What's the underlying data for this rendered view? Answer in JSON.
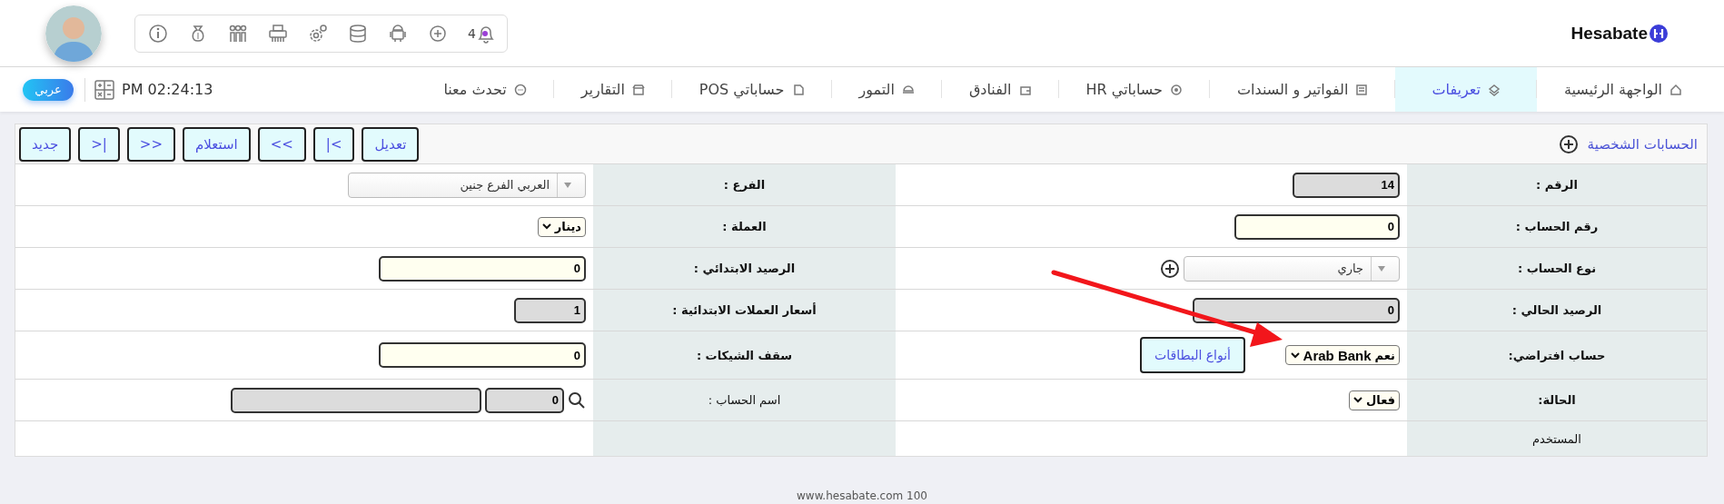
{
  "header": {
    "logo": "Hesabate",
    "notification_count": "4"
  },
  "nav": {
    "language_button": "عربي",
    "clock": "PM 02:24:13",
    "tabs": [
      {
        "label": "الواجهة الرئيسية",
        "selected": false
      },
      {
        "label": "تعريفات",
        "selected": true
      },
      {
        "label": "الفواتير و السندات",
        "selected": false
      },
      {
        "label": "حساباتي HR",
        "selected": false
      },
      {
        "label": "الفنادق",
        "selected": false
      },
      {
        "label": "التمور",
        "selected": false
      },
      {
        "label": "حساباتي POS",
        "selected": false
      },
      {
        "label": "التقارير",
        "selected": false
      },
      {
        "label": "تحدث معنا",
        "selected": false
      }
    ]
  },
  "panel": {
    "title": "الحسابات الشخصية",
    "buttons": [
      "تعديل",
      "|<",
      "<<",
      "استعلام",
      ">>",
      ">|",
      "جديد"
    ],
    "rows": [
      {
        "cells": [
          {
            "label": "الرقم :",
            "controls": [
              {
                "kind": "input",
                "value": "14",
                "readonly": true
              }
            ]
          },
          {
            "label": "الفرع :",
            "controls": [
              {
                "kind": "combo",
                "value": "العربي الفرع جنين"
              }
            ]
          }
        ]
      },
      {
        "cells": [
          {
            "label": "رقم الحساب :",
            "controls": [
              {
                "kind": "input",
                "value": "0",
                "readonly": false
              }
            ]
          },
          {
            "label": "العملة :",
            "controls": [
              {
                "kind": "select",
                "value": "دينار"
              }
            ]
          }
        ]
      },
      {
        "cells": [
          {
            "label": "نوع الحساب :",
            "controls": [
              {
                "kind": "combo",
                "value": "جاري"
              },
              {
                "kind": "add"
              }
            ]
          },
          {
            "label": "الرصيد الابتدائي :",
            "controls": [
              {
                "kind": "input",
                "value": "0",
                "readonly": false
              }
            ]
          }
        ]
      },
      {
        "cells": [
          {
            "label": "الرصيد الحالي :",
            "controls": [
              {
                "kind": "input",
                "value": "0",
                "readonly": true
              }
            ]
          },
          {
            "label": "أسعار العملات الابتدائية :",
            "controls": [
              {
                "kind": "input",
                "value": "1",
                "readonly": true
              }
            ]
          }
        ]
      },
      {
        "cells": [
          {
            "label": "حساب افتراضي:",
            "controls": [
              {
                "kind": "select",
                "value": "نعم",
                "note": "Arab Bank"
              },
              {
                "kind": "button",
                "label": "أنواع البطاقات"
              }
            ]
          },
          {
            "label": "سقف الشيكات :",
            "controls": [
              {
                "kind": "input",
                "value": "0",
                "readonly": false
              }
            ]
          }
        ]
      },
      {
        "cells": [
          {
            "label": "الحالة:",
            "controls": [
              {
                "kind": "select",
                "value": "فعال"
              }
            ]
          },
          {
            "label": "اسم الحساب :",
            "controls": [
              {
                "kind": "search"
              },
              {
                "kind": "input",
                "value": "0",
                "readonly": true
              },
              {
                "kind": "input",
                "readonly": true
              }
            ]
          }
        ]
      },
      {
        "cells": [
          {
            "label": "المستخدم"
          },
          {}
        ]
      }
    ]
  },
  "footer": "www.hesabate.com 100"
}
